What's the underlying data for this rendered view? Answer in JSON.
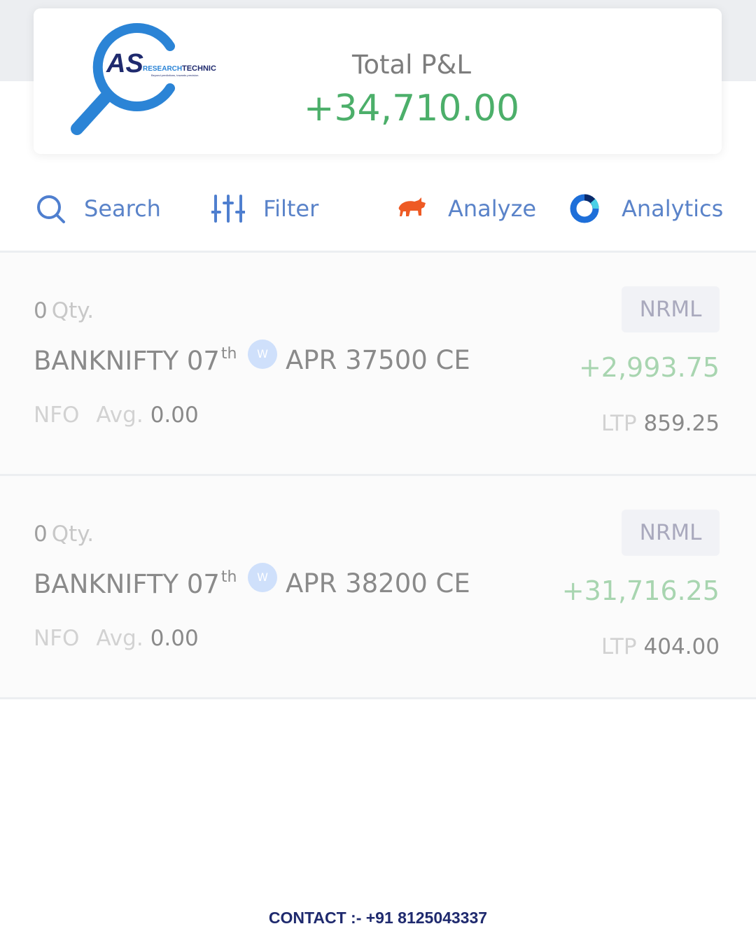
{
  "brand": {
    "logo_initials": "AS",
    "logo_name_part1": "RESEARCH",
    "logo_name_part2": "TECHNIC",
    "logo_tagline": "Beyond predictions, towards precision."
  },
  "summary": {
    "label": "Total P&L",
    "value": "+34,710.00",
    "value_color": "#4caf6a"
  },
  "toolbar": {
    "search_label": "Search",
    "filter_label": "Filter",
    "analyze_label": "Analyze",
    "analytics_label": "Analytics",
    "icons": [
      "search-icon",
      "filter-icon",
      "bull-icon",
      "analytics-ring-icon"
    ],
    "accent_color": "#5a83c9"
  },
  "positions": [
    {
      "qty": "0",
      "qty_unit": "Qty.",
      "symbol": "BANKNIFTY 07",
      "symbol_sup": "th",
      "badge": "W",
      "symbol_rest": "APR 37500 CE",
      "exchange": "NFO",
      "avg_label": "Avg.",
      "avg_value": "0.00",
      "product": "NRML",
      "pnl": "+2,993.75",
      "ltp_label": "LTP",
      "ltp_value": "859.25"
    },
    {
      "qty": "0",
      "qty_unit": "Qty.",
      "symbol": "BANKNIFTY 07",
      "symbol_sup": "th",
      "badge": "W",
      "symbol_rest": "APR 38200 CE",
      "exchange": "NFO",
      "avg_label": "Avg.",
      "avg_value": "0.00",
      "product": "NRML",
      "pnl": "+31,716.25",
      "ltp_label": "LTP",
      "ltp_value": "404.00"
    }
  ],
  "footer": {
    "contact": "CONTACT  :-  +91 8125043337"
  }
}
